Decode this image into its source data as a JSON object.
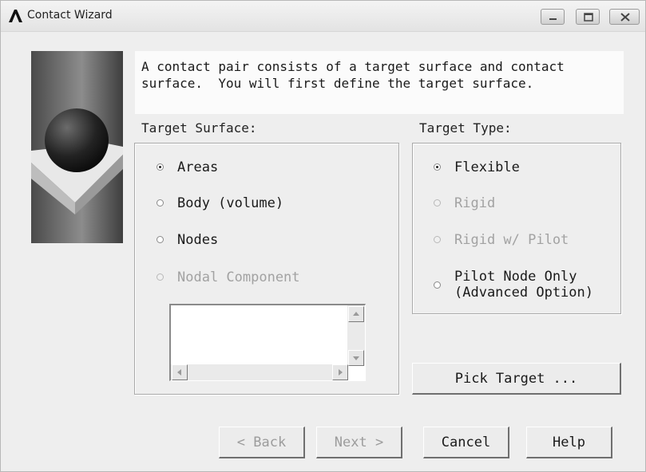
{
  "window": {
    "title": "Contact Wizard",
    "controls": [
      "minimize-icon",
      "maximize-icon",
      "close-icon"
    ]
  },
  "info": {
    "line1": "A contact pair consists of a target surface and contact",
    "line2": "surface.  You will first define the target surface."
  },
  "target_surface": {
    "label": "Target Surface:",
    "options": [
      {
        "label": "Areas",
        "selected": true,
        "enabled": true
      },
      {
        "label": "Body (volume)",
        "selected": false,
        "enabled": true
      },
      {
        "label": "Nodes",
        "selected": false,
        "enabled": true
      },
      {
        "label": "Nodal Component",
        "selected": false,
        "enabled": false
      }
    ]
  },
  "target_type": {
    "label": "Target Type:",
    "options": [
      {
        "label": "Flexible",
        "selected": true,
        "enabled": true
      },
      {
        "label": "Rigid",
        "selected": false,
        "enabled": false
      },
      {
        "label": "Rigid w/ Pilot",
        "selected": false,
        "enabled": false
      },
      {
        "label": "Pilot Node Only",
        "label2": "(Advanced Option)",
        "selected": false,
        "enabled": true
      }
    ]
  },
  "buttons": {
    "pick_target": "Pick Target ...",
    "back": "< Back",
    "next": "Next >",
    "cancel": "Cancel",
    "help": "Help"
  },
  "colors": {
    "window_bg": "#eeeeee",
    "disabled_text": "#a2a2a2"
  }
}
